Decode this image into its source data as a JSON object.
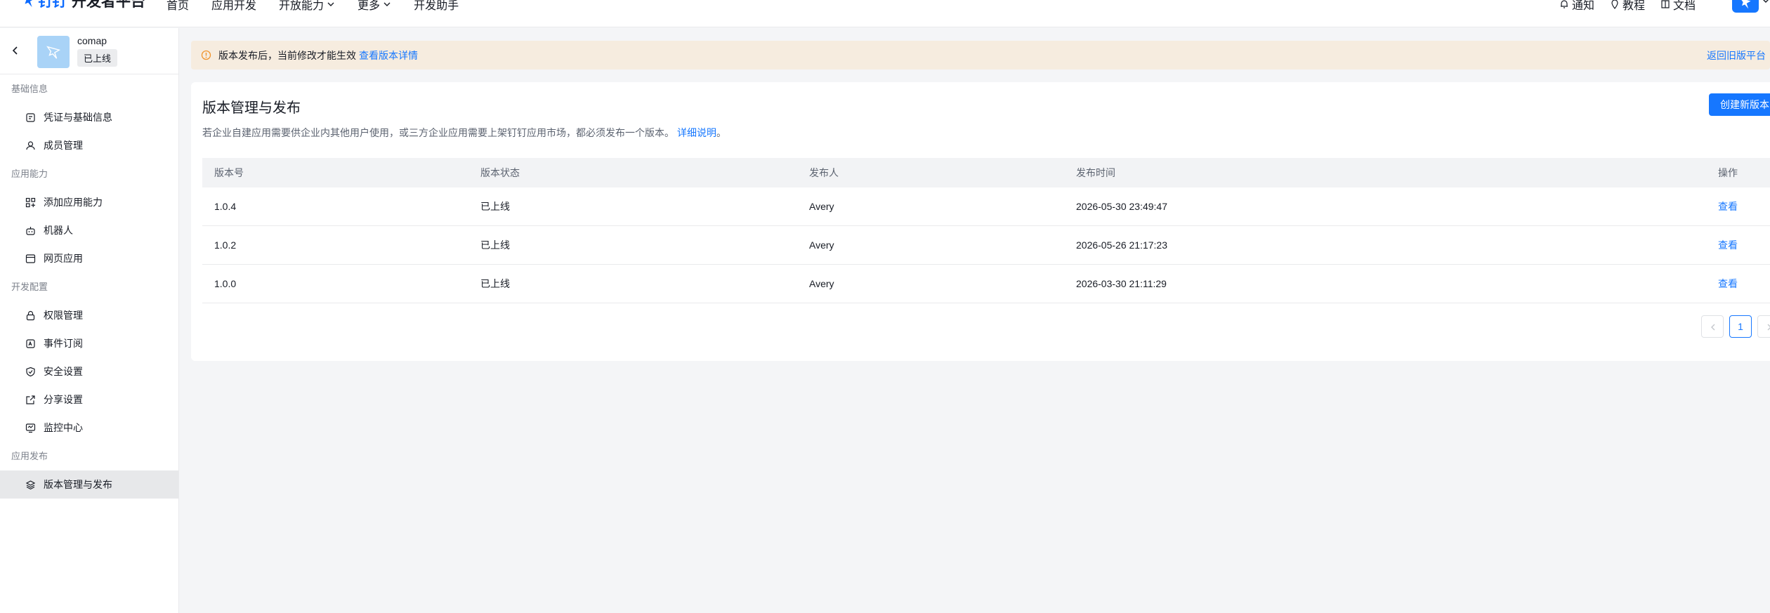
{
  "topbar": {
    "logo_brand": "钉钉",
    "logo_title": "开发者平台",
    "nav": [
      "首页",
      "应用开发",
      "开放能力",
      "更多",
      "开发助手"
    ],
    "right": {
      "notify": "通知",
      "tutorial": "教程",
      "docs": "文档"
    }
  },
  "app": {
    "name": "comap",
    "status": "已上线"
  },
  "sidebar": {
    "groups": [
      {
        "title": "基础信息",
        "items": [
          "凭证与基础信息",
          "成员管理"
        ]
      },
      {
        "title": "应用能力",
        "items": [
          "添加应用能力",
          "机器人",
          "网页应用"
        ]
      },
      {
        "title": "开发配置",
        "items": [
          "权限管理",
          "事件订阅",
          "安全设置",
          "分享设置",
          "监控中心"
        ]
      },
      {
        "title": "应用发布",
        "items": [
          "版本管理与发布"
        ]
      }
    ],
    "active_item": "版本管理与发布"
  },
  "banner": {
    "text": "版本发布后，当前修改才能生效",
    "link": "查看版本详情",
    "right_link": "返回旧版平台"
  },
  "page": {
    "title": "版本管理与发布",
    "create_button": "创建新版本",
    "description": "若企业自建应用需要供企业内其他用户使用，或三方企业应用需要上架钉钉应用市场，都必须发布一个版本。",
    "description_link": "详细说明",
    "description_tail": "。"
  },
  "table": {
    "headers": [
      "版本号",
      "版本状态",
      "发布人",
      "发布时间",
      "操作"
    ],
    "rows": [
      {
        "version": "1.0.4",
        "status": "已上线",
        "publisher": "Avery",
        "time": "2026-05-30 23:49:47",
        "action": "查看"
      },
      {
        "version": "1.0.2",
        "status": "已上线",
        "publisher": "Avery",
        "time": "2026-05-26 21:17:23",
        "action": "查看"
      },
      {
        "version": "1.0.0",
        "status": "已上线",
        "publisher": "Avery",
        "time": "2026-03-30 21:11:29",
        "action": "查看"
      }
    ]
  },
  "pagination": {
    "current": "1"
  },
  "colors": {
    "accent": "#1677ff",
    "banner_bg": "#f6ecdf",
    "warn": "#f0932b"
  }
}
